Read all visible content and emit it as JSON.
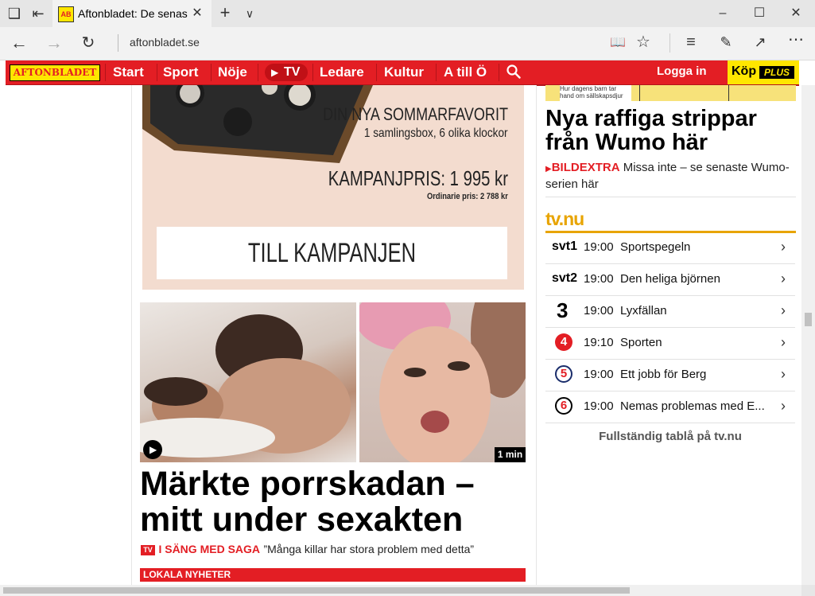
{
  "browser": {
    "tab_title": "Aftonbladet: De senaste",
    "url": "aftonbladet.se",
    "favicon_text": "AB"
  },
  "nav": {
    "logo": "AFTONBLADET",
    "items": [
      "Start",
      "Sport",
      "Nöje",
      "TV",
      "Ledare",
      "Kultur",
      "A till Ö"
    ],
    "login": "Logga in",
    "buy": "Köp",
    "plus": "PLUS"
  },
  "ad": {
    "headline": "DIN NYA SOMMARFAVORIT",
    "subline": "1 samlingsbox, 6 olika klockor",
    "price": "KAMPANJPRIS: 1 995 kr",
    "ordinary": "Ordinarie pris: 2 788 kr",
    "cta": "TILL KAMPANJEN"
  },
  "article": {
    "duration": "1 min",
    "headline": "Märkte porrskadan – mitt under sexakten",
    "badge": "TV",
    "kicker": "I SÄNG MED SAGA",
    "quote": "”Många killar har stora problem med detta”"
  },
  "section": {
    "label": "LOKALA NYHETER"
  },
  "sidebar": {
    "comic_caption": "Hur dagens barn tar hand om sällskapsdjur",
    "headline": "Nya raffiga strippar från Wumo här",
    "kicker": "BILDEXTRA",
    "teaser": "Missa inte – se senaste Wumo-serien här"
  },
  "tvnu": {
    "logo": "tv.nu",
    "rows": [
      {
        "channel": "svt1",
        "time": "19:00",
        "title": "Sportspegeln"
      },
      {
        "channel": "svt2",
        "time": "19:00",
        "title": "Den heliga björnen"
      },
      {
        "channel": "3",
        "time": "19:00",
        "title": "Lyxfällan"
      },
      {
        "channel": "4",
        "time": "19:10",
        "title": "Sporten"
      },
      {
        "channel": "5",
        "time": "19:00",
        "title": "Ett jobb för Berg"
      },
      {
        "channel": "6",
        "time": "19:00",
        "title": "Nemas problemas med E..."
      }
    ],
    "full_link": "Fullständig tablå på tv.nu"
  },
  "colors": {
    "brand_red": "#e31e24",
    "brand_yellow": "#ffe600",
    "tvnu_yellow": "#e8a400",
    "ad_bg": "#f3dccf"
  }
}
